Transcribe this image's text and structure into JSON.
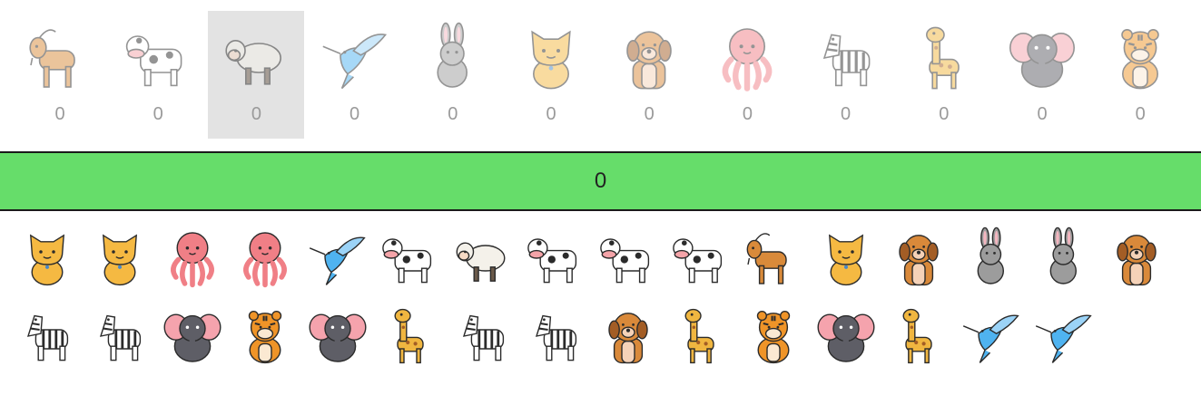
{
  "slots": [
    {
      "animal": "goat",
      "count": "0",
      "selected": false
    },
    {
      "animal": "cow",
      "count": "0",
      "selected": false
    },
    {
      "animal": "sheep",
      "count": "0",
      "selected": true
    },
    {
      "animal": "hummingbird",
      "count": "0",
      "selected": false
    },
    {
      "animal": "rabbit",
      "count": "0",
      "selected": false
    },
    {
      "animal": "cat",
      "count": "0",
      "selected": false
    },
    {
      "animal": "dog",
      "count": "0",
      "selected": false
    },
    {
      "animal": "octopus",
      "count": "0",
      "selected": false
    },
    {
      "animal": "zebra",
      "count": "0",
      "selected": false
    },
    {
      "animal": "giraffe",
      "count": "0",
      "selected": false
    },
    {
      "animal": "elephant",
      "count": "0",
      "selected": false
    },
    {
      "animal": "tiger",
      "count": "0",
      "selected": false
    }
  ],
  "score": "0",
  "pool_rows": [
    [
      "cat",
      "cat",
      "octopus",
      "octopus",
      "hummingbird",
      "cow",
      "sheep",
      "cow",
      "cow",
      "cow",
      "goat",
      "cat",
      "dog",
      "rabbit",
      "rabbit",
      "dog"
    ],
    [
      "zebra",
      "zebra",
      "elephant",
      "tiger",
      "elephant",
      "giraffe",
      "zebra",
      "zebra",
      "dog",
      "giraffe",
      "tiger",
      "elephant",
      "giraffe",
      "hummingbird",
      "hummingbird"
    ]
  ],
  "animal_colors": {
    "goat": "#d98a3a",
    "cow": "#ffffff",
    "sheep": "#f4f1ea",
    "hummingbird": "#4fb3f0",
    "rabbit": "#9c9c9c",
    "cat": "#f5b942",
    "dog": "#d9893a",
    "octopus": "#f07f86",
    "zebra": "#ffffff",
    "giraffe": "#f0b640",
    "elephant": "#5e5e66",
    "tiger": "#ef9428"
  }
}
